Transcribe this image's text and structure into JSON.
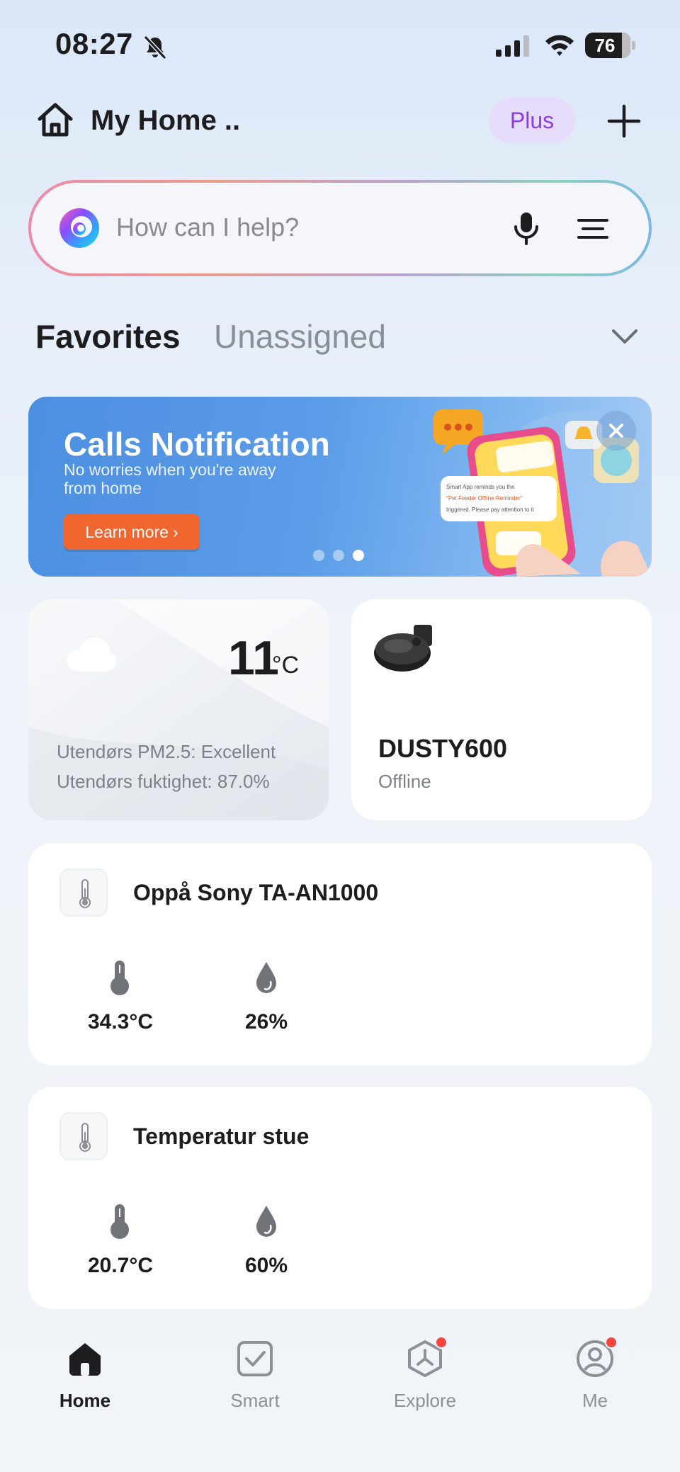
{
  "status_bar": {
    "time": "08:27",
    "battery": "76",
    "icons": [
      "bell-slash-icon",
      "signal-icon",
      "wifi-icon",
      "battery-icon"
    ]
  },
  "header": {
    "title": "My Home ..",
    "plus_label": "Plus",
    "icons": [
      "home-icon",
      "add-icon"
    ]
  },
  "search": {
    "placeholder": "How can I help?",
    "icons": [
      "assistant-logo-icon",
      "microphone-icon",
      "filter-menu-icon"
    ]
  },
  "tabs": [
    {
      "label": "Favorites",
      "active": true
    },
    {
      "label": "Unassigned",
      "active": false
    }
  ],
  "banner": {
    "title": "Calls Notification",
    "subtitle": "No worries when you're away from home",
    "button_label": "Learn more",
    "art_bubble_line1": "Smart App reminds you the",
    "art_bubble_line2": "\"Pet Feeder Offline Reminder\"",
    "art_bubble_line3": "triggered. Please pay attention to it",
    "page_count": 3,
    "active_page": 3,
    "accent_color": "#f1652f"
  },
  "weather": {
    "temperature": "11",
    "unit": "°C",
    "pm25": "Utendørs PM2.5: Excellent",
    "humidity": "Utendørs fuktighet: 87.0%",
    "icon": "cloud-icon"
  },
  "robot": {
    "name": "DUSTY600",
    "status": "Offline",
    "icon": "robot-vacuum-icon"
  },
  "sensors": [
    {
      "name": "Oppå Sony TA-AN1000",
      "temperature": "34.3°C",
      "humidity": "26%"
    },
    {
      "name": "Temperatur stue",
      "temperature": "20.7°C",
      "humidity": "60%"
    }
  ],
  "nav": [
    {
      "label": "Home",
      "icon": "home-icon",
      "active": true,
      "badge": false
    },
    {
      "label": "Smart",
      "icon": "smart-checkbox-icon",
      "active": false,
      "badge": false
    },
    {
      "label": "Explore",
      "icon": "explore-icon",
      "active": false,
      "badge": true
    },
    {
      "label": "Me",
      "icon": "profile-icon",
      "active": false,
      "badge": true
    }
  ],
  "colors": {
    "badge_red": "#f2453d",
    "plus_purple": "#8a3fe0",
    "banner_blue": "#4d8fe0"
  }
}
